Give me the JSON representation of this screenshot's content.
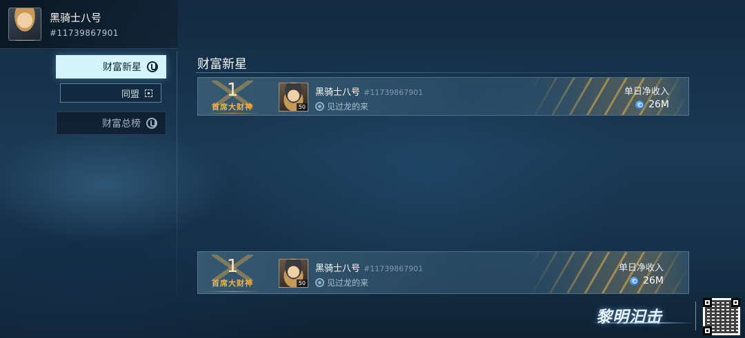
{
  "profile": {
    "name": "黑骑士八号",
    "id": "#11739867901"
  },
  "sidebar": {
    "items": [
      {
        "label": "财富新星",
        "icon": "coin-icon",
        "state": "active"
      },
      {
        "label": "同盟",
        "icon": "focus-icon",
        "state": "sub"
      },
      {
        "label": "财富总榜",
        "icon": "coin-icon",
        "state": "default"
      }
    ]
  },
  "main": {
    "title": "财富新星",
    "rows": [
      {
        "rank": "1",
        "rank_title": "首席大财神",
        "name": "黑骑士八号",
        "player_id": "#11739867901",
        "level": "50",
        "alliance": "见过龙的来",
        "stat_label": "单日净收入",
        "stat_value": "26M"
      }
    ],
    "my_row": {
      "rank": "1",
      "rank_title": "首席大财神",
      "name": "黑骑士八号",
      "player_id": "#11739867901",
      "level": "50",
      "alliance": "见过龙的来",
      "stat_label": "单日净收入",
      "stat_value": "26M"
    }
  },
  "branding": {
    "logo_text": "黎明汩击"
  },
  "colors": {
    "accent_active_tab": "#d4f5fb",
    "rank_title_gold": "#f3b43a",
    "background_dark": "#132a40"
  }
}
